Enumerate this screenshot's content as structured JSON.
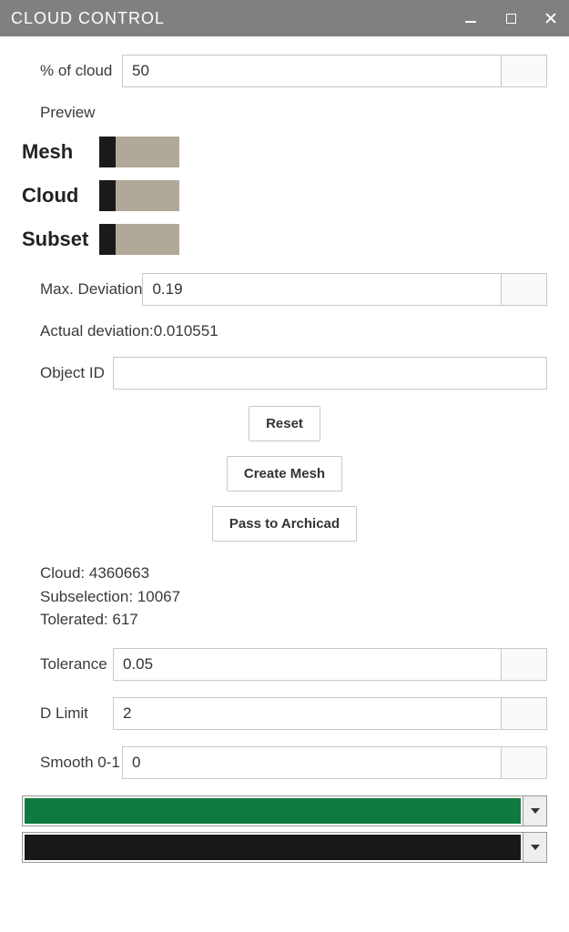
{
  "window": {
    "title": "CLOUD CONTROL"
  },
  "fields": {
    "percent_cloud": {
      "label": "% of cloud",
      "value": "50"
    },
    "preview_label": "Preview",
    "toggles": {
      "mesh": {
        "label": "Mesh"
      },
      "cloud": {
        "label": "Cloud"
      },
      "subset": {
        "label": "Subset"
      }
    },
    "max_deviation": {
      "label": "Max. Deviation",
      "value": "0.19"
    },
    "actual_deviation": {
      "label": "Actual deviation:",
      "value": "0.010551"
    },
    "object_id": {
      "label": "Object ID",
      "value": ""
    },
    "tolerance": {
      "label": "Tolerance",
      "value": "0.05"
    },
    "d_limit": {
      "label": "D Limit",
      "value": "2"
    },
    "smooth": {
      "label": "Smooth 0-1",
      "value": "0"
    }
  },
  "buttons": {
    "reset": "Reset",
    "create_mesh": "Create Mesh",
    "pass_to_archicad": "Pass to Archicad"
  },
  "stats": {
    "cloud": {
      "label": "Cloud: ",
      "value": "4360663"
    },
    "subselection": {
      "label": "Subselection: ",
      "value": "10067"
    },
    "tolerated": {
      "label": "Tolerated: ",
      "value": "617"
    }
  },
  "colors": {
    "dropdown1": "#0f7a3f",
    "dropdown2": "#181818"
  }
}
